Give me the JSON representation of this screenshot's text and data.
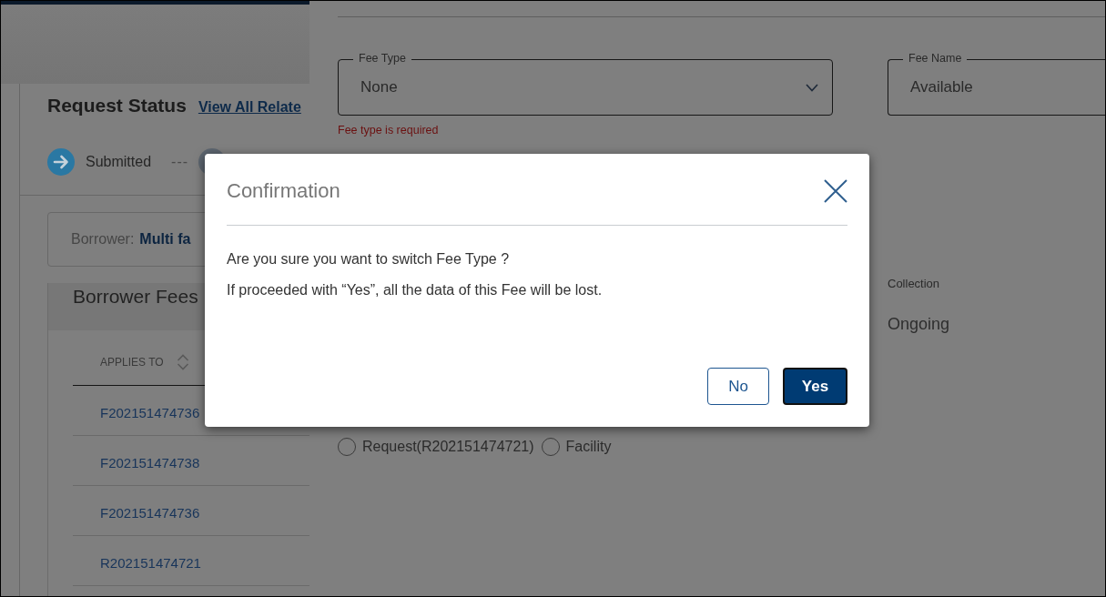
{
  "left_panel": {
    "request_status": {
      "title": "Request Status",
      "link": "View All Relate",
      "steps": [
        {
          "label": "Submitted",
          "kind": "current"
        },
        {
          "kind": "pending",
          "connector": "---"
        }
      ]
    },
    "borrower": {
      "label": "Borrower:",
      "value": "Multi fa"
    },
    "borrower_fees": {
      "title": "Borrower Fees",
      "columns": [
        {
          "label": "APPLIES TO",
          "sortable": true
        }
      ],
      "rows": [
        [
          "F202151474736"
        ],
        [
          "F202151474738"
        ],
        [
          "F202151474736"
        ],
        [
          "R202151474721"
        ]
      ]
    }
  },
  "fee_form": {
    "fields": [
      {
        "label": "Fee Type",
        "value": "None",
        "kind": "select",
        "error": "Fee type is required"
      },
      {
        "label": "Fee Name",
        "value": "Available",
        "kind": "text"
      }
    ],
    "collection": {
      "label": "Collection",
      "value": "Ongoing"
    },
    "applies_to_options": [
      {
        "label": "Request(R202151474721)",
        "selected": false
      },
      {
        "label": "Facility",
        "selected": false
      }
    ]
  },
  "dialog": {
    "title": "Confirmation",
    "messages": [
      "Are you sure you want to switch Fee Type ?",
      "If proceeded with “Yes”, all the data of this Fee will be lost."
    ],
    "buttons": [
      {
        "label": "No",
        "kind": "secondary",
        "focused": false
      },
      {
        "label": "Yes",
        "kind": "primary",
        "focused": true
      }
    ]
  }
}
